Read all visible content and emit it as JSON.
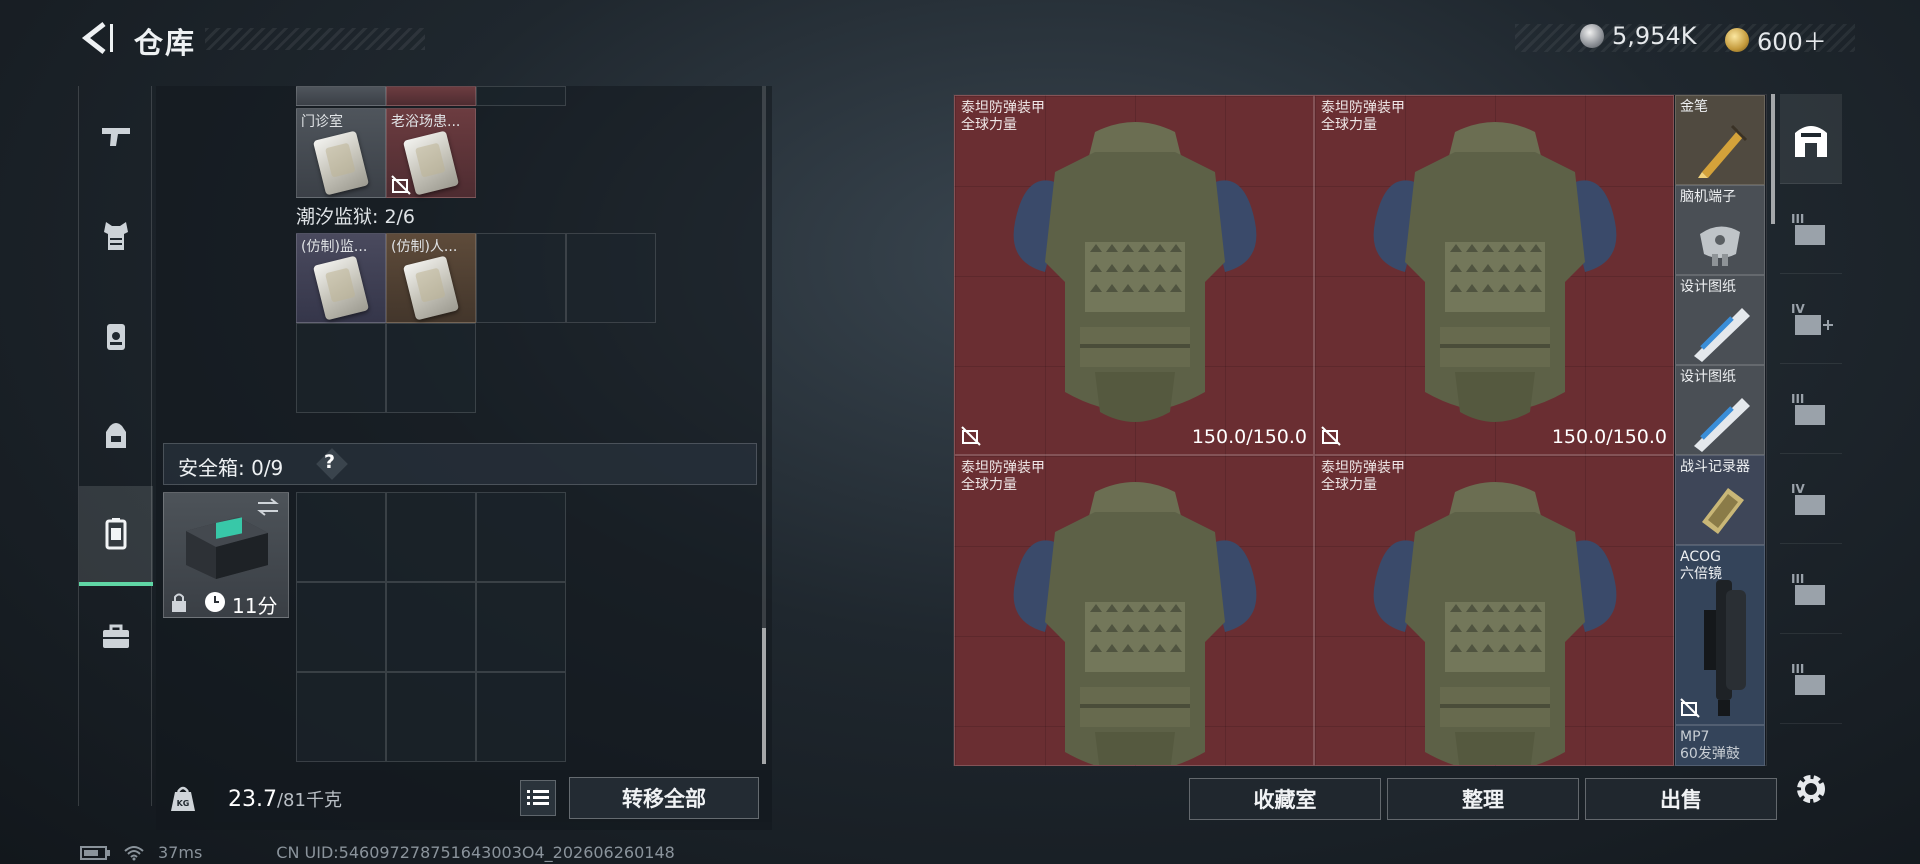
{
  "header": {
    "title": "仓库",
    "currency_silver": "5,954K",
    "currency_gold": "600＋"
  },
  "left_tabs": [
    {
      "name": "weapons",
      "icon": "pistol-icon"
    },
    {
      "name": "armor",
      "icon": "vest-icon"
    },
    {
      "name": "rig",
      "icon": "rig-icon"
    },
    {
      "name": "backpack",
      "icon": "backpack-icon"
    },
    {
      "name": "key-case",
      "icon": "key-case-icon",
      "active": true
    },
    {
      "name": "toolbox",
      "icon": "toolbox-icon"
    }
  ],
  "keycards": {
    "row1": [
      {
        "label": "门诊室",
        "color": "gray"
      },
      {
        "label": "老浴场患...",
        "color": "red"
      }
    ],
    "section_label": "潮汐监狱: 2/6",
    "row2": [
      {
        "label": "(仿制)监...",
        "color": "purple"
      },
      {
        "label": "(仿制)人...",
        "color": "brown"
      }
    ]
  },
  "safe_box": {
    "label": "安全箱: 0/9",
    "help": "?",
    "timer": "11分"
  },
  "footer": {
    "weight": "23.7",
    "weight_max": "/81千克",
    "transfer_label": "转移全部"
  },
  "status": {
    "ping": "37ms",
    "uid": "CN UID:546097278751643003O4_202606260148"
  },
  "stash": {
    "armors": [
      {
        "name1": "泰坦防弹装甲",
        "name2": "全球力量",
        "durability": "150.0/150.0"
      },
      {
        "name1": "泰坦防弹装甲",
        "name2": "全球力量",
        "durability": "150.0/150.0"
      },
      {
        "name1": "泰坦防弹装甲",
        "name2": "全球力量",
        "durability": ""
      },
      {
        "name1": "泰坦防弹装甲",
        "name2": "全球力量",
        "durability": ""
      }
    ],
    "side_items": [
      {
        "label": "金笔"
      },
      {
        "label": "脑机端子"
      },
      {
        "label": "设计图纸"
      },
      {
        "label": "设计图纸"
      },
      {
        "label": "战斗记录器"
      },
      {
        "label": "ACOG\n六倍镜"
      },
      {
        "label": "MP7\n60发弹鼓"
      }
    ]
  },
  "buttons": {
    "collection": "收藏室",
    "sort": "整理",
    "sell": "出售"
  },
  "right_tabs": [
    {
      "name": "stash-home",
      "label": ""
    },
    {
      "name": "stash-III-a",
      "label": "III"
    },
    {
      "name": "stash-IV-add",
      "label": "IV"
    },
    {
      "name": "stash-III-b",
      "label": "III"
    },
    {
      "name": "stash-IV",
      "label": "IV"
    },
    {
      "name": "stash-III-c",
      "label": "III"
    },
    {
      "name": "stash-III-d",
      "label": "III"
    }
  ]
}
